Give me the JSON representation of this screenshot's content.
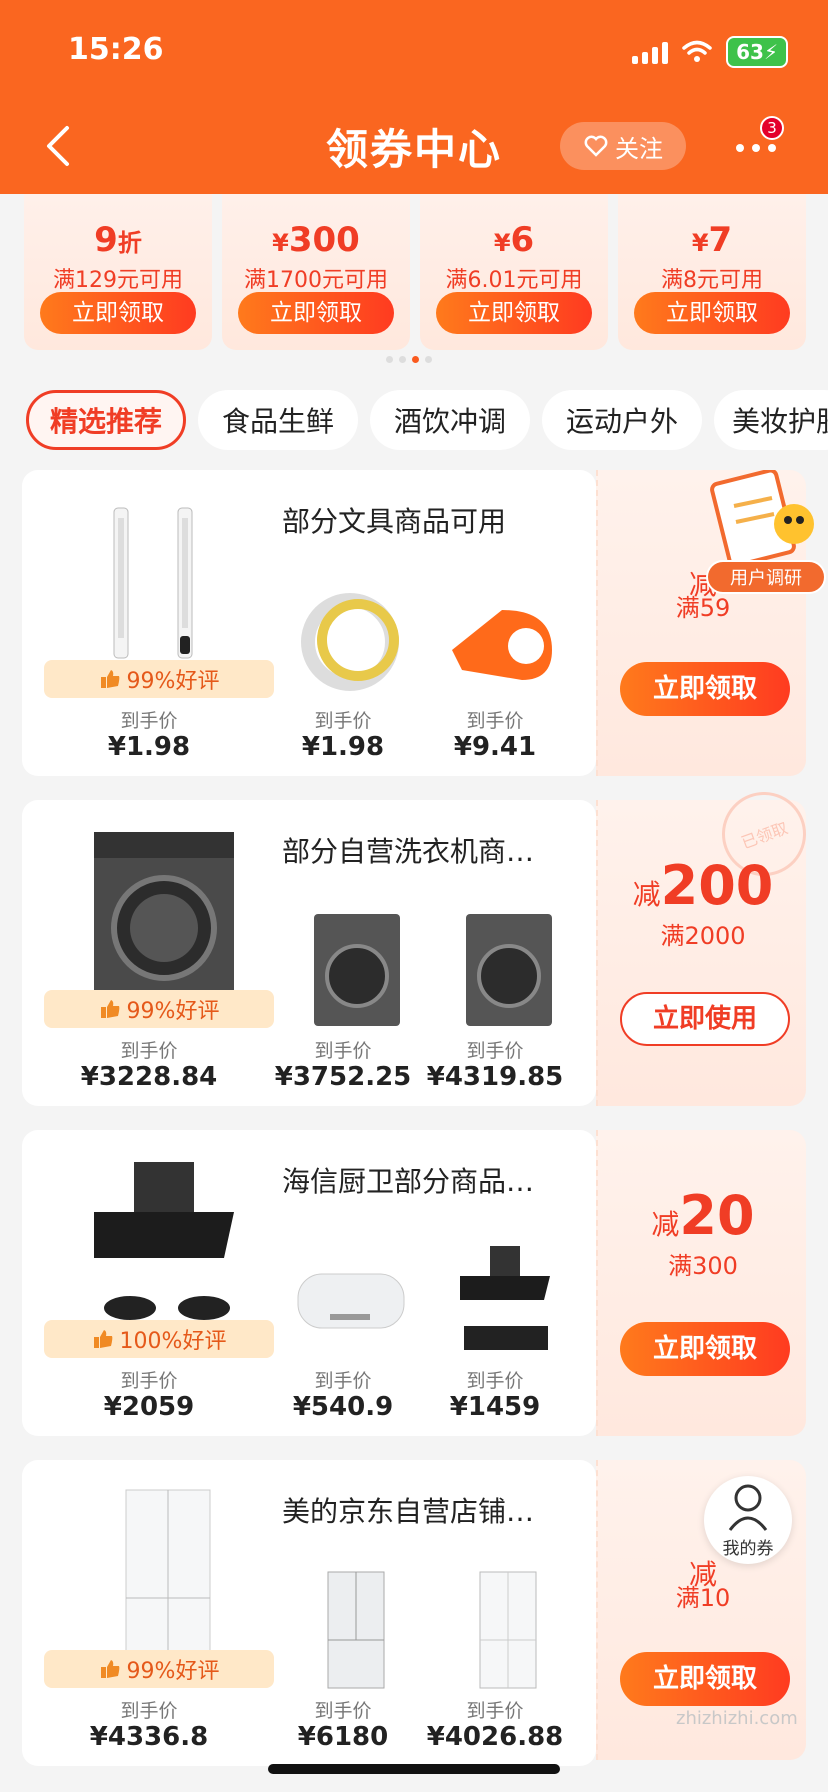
{
  "status_bar": {
    "time": "15:26",
    "battery": "63"
  },
  "header": {
    "title": "领券中心",
    "follow_label": "关注",
    "more_badge": "3"
  },
  "top_coupons": [
    {
      "amount": "9",
      "unit": "折",
      "prefix": "",
      "condition": "满129元可用",
      "button": "立即领取"
    },
    {
      "amount": "300",
      "unit": "",
      "prefix": "¥",
      "condition": "满1700元可用",
      "button": "立即领取"
    },
    {
      "amount": "6",
      "unit": "",
      "prefix": "¥",
      "condition": "满6.01元可用",
      "button": "立即领取"
    },
    {
      "amount": "7",
      "unit": "",
      "prefix": "¥",
      "condition": "满8元可用",
      "button": "立即领取"
    }
  ],
  "carousel": {
    "active_index": 2,
    "count": 4
  },
  "tabs": [
    "精选推荐",
    "食品生鲜",
    "酒饮冲调",
    "运动户外",
    "美妆护肤"
  ],
  "cards": [
    {
      "title": "部分文具商品可用",
      "rating": "99%好评",
      "prices": [
        {
          "label": "到手价",
          "value": "¥1.98"
        },
        {
          "label": "到手价",
          "value": "¥1.98"
        },
        {
          "label": "到手价",
          "value": "¥9.41"
        }
      ],
      "coupon_prefix": "减",
      "coupon_amount": "",
      "coupon_condition": "满59",
      "button": "立即领取",
      "button_style": "solid",
      "stamp": ""
    },
    {
      "title": "部分自营洗衣机商…",
      "rating": "99%好评",
      "prices": [
        {
          "label": "到手价",
          "value": "¥3228.84"
        },
        {
          "label": "到手价",
          "value": "¥3752.25"
        },
        {
          "label": "到手价",
          "value": "¥4319.85"
        }
      ],
      "coupon_prefix": "减",
      "coupon_amount": "200",
      "coupon_condition": "满2000",
      "button": "立即使用",
      "button_style": "outline",
      "stamp": "已领取"
    },
    {
      "title": "海信厨卫部分商品…",
      "rating": "100%好评",
      "prices": [
        {
          "label": "到手价",
          "value": "¥2059"
        },
        {
          "label": "到手价",
          "value": "¥540.9"
        },
        {
          "label": "到手价",
          "value": "¥1459"
        }
      ],
      "coupon_prefix": "减",
      "coupon_amount": "20",
      "coupon_condition": "满300",
      "button": "立即领取",
      "button_style": "solid",
      "stamp": ""
    },
    {
      "title": "美的京东自营店铺…",
      "rating": "99%好评",
      "prices": [
        {
          "label": "到手价",
          "value": "¥4336.8"
        },
        {
          "label": "到手价",
          "value": "¥6180"
        },
        {
          "label": "到手价",
          "value": "¥4026.88"
        }
      ],
      "coupon_prefix": "减",
      "coupon_amount": "",
      "coupon_condition": "满10",
      "button": "立即领取",
      "button_style": "solid",
      "stamp": ""
    }
  ],
  "floating": {
    "survey_label": "用户调研",
    "my_coupon_label": "我的券"
  },
  "watermark": "zhizhizhi.com",
  "colors": {
    "brand": "#fa6620",
    "accent": "#f03d25"
  }
}
